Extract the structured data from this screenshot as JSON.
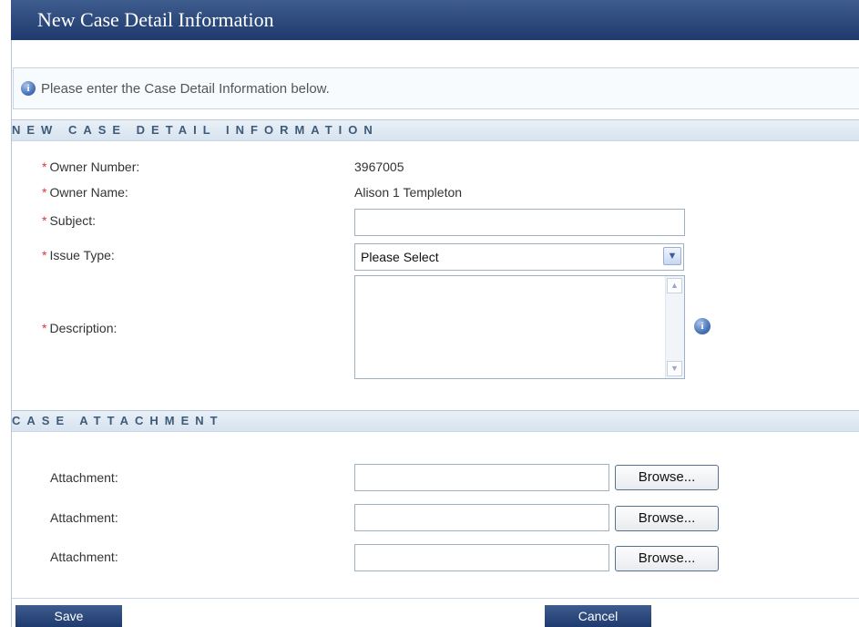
{
  "header": {
    "title": "New Case Detail Information"
  },
  "banner": {
    "message": "Please enter the Case Detail Information below."
  },
  "sections": {
    "details": {
      "title": "NEW CASE DETAIL INFORMATION"
    },
    "attachments": {
      "title": "CASE ATTACHMENT"
    }
  },
  "form": {
    "required_marker": "*",
    "owner_number": {
      "label": "Owner Number:",
      "value": "3967005"
    },
    "owner_name": {
      "label": "Owner Name:",
      "value": "Alison 1 Templeton"
    },
    "subject": {
      "label": "Subject:",
      "value": ""
    },
    "issue_type": {
      "label": "Issue Type:",
      "selected": "Please Select"
    },
    "description": {
      "label": "Description:",
      "value": ""
    }
  },
  "attachments": [
    {
      "label": "Attachment:",
      "browse_label": "Browse..."
    },
    {
      "label": "Attachment:",
      "browse_label": "Browse..."
    },
    {
      "label": "Attachment:",
      "browse_label": "Browse..."
    }
  ],
  "actions": {
    "save_label": "Save",
    "cancel_label": "Cancel"
  },
  "icons": {
    "info": "info-icon",
    "dropdown": "chevron-down-icon"
  },
  "colors": {
    "header_bg": "#2a4677",
    "required": "#d9393b",
    "section_text": "#3d5a7a"
  }
}
